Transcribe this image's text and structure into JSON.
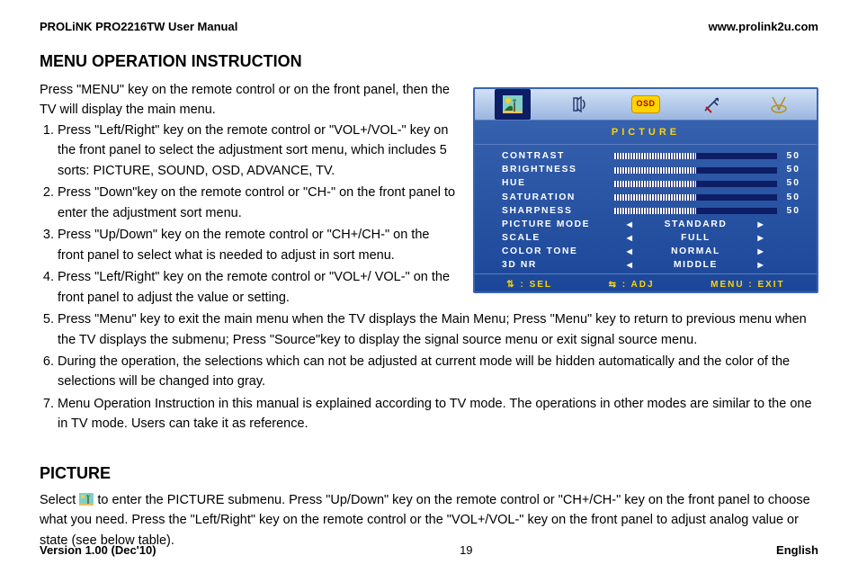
{
  "header": {
    "left": "PROLiNK PRO2216TW User Manual",
    "right": "www.prolink2u.com"
  },
  "section1": {
    "title": "MENU OPERATION INSTRUCTION",
    "lead": "Press \"MENU\" key on the remote control or on the front panel, then the TV will display the main menu.",
    "steps": [
      "Press \"Left/Right\" key on the remote control or \"VOL+/VOL-\" key on the front panel to select the adjustment sort menu, which includes 5 sorts: PICTURE, SOUND, OSD, ADVANCE, TV.",
      "Press \"Down\"key on the remote control or \"CH-\" on the front panel to enter the adjustment sort menu.",
      "Press \"Up/Down\" key on the remote control or \"CH+/CH-\" on the front panel to select what is needed to adjust in sort menu.",
      "Press \"Left/Right\" key on the remote control or \"VOL+/ VOL-\" on the front panel to adjust the value or setting.",
      "Press \"Menu\" key to exit  the main menu when the TV displays the Main Menu; Press \"Menu\" key to return to previous menu when the TV displays the submenu; Press \"Source\"key to display the signal source menu or exit signal source menu.",
      "During the operation, the selections which can not be adjusted at current mode will be hidden automatically and the color of the selections will be changed into gray.",
      "Menu Operation Instruction in this manual is explained according to TV mode. The operations in other modes are similar to the one in TV mode. Users can take it as reference."
    ]
  },
  "osd": {
    "title": "PICTURE",
    "tabs": [
      {
        "name": "picture-tab-icon",
        "active": true
      },
      {
        "name": "sound-tab-icon",
        "active": false
      },
      {
        "name": "osd-tab-icon",
        "active": false,
        "osd": true,
        "label": "OSD"
      },
      {
        "name": "advance-tab-icon",
        "active": false
      },
      {
        "name": "tv-tab-icon",
        "active": false
      }
    ],
    "sliders": [
      {
        "label": "CONTRAST",
        "value": "50"
      },
      {
        "label": "BRIGHTNESS",
        "value": "50"
      },
      {
        "label": "HUE",
        "value": "50"
      },
      {
        "label": "SATURATION",
        "value": "50"
      },
      {
        "label": "SHARPNESS",
        "value": "50"
      }
    ],
    "selects": [
      {
        "label": "PICTURE MODE",
        "value": "STANDARD"
      },
      {
        "label": "SCALE",
        "value": "FULL"
      },
      {
        "label": "COLOR TONE",
        "value": "NORMAL"
      },
      {
        "label": "3D NR",
        "value": "MIDDLE"
      }
    ],
    "footer": {
      "sel": "⇅ : SEL",
      "adj": "⇆ : ADJ",
      "exit": "MENU : EXIT"
    }
  },
  "section2": {
    "title": "PICTURE",
    "body_before": "Select ",
    "body_after": " to enter the PICTURE submenu. Press \"Up/Down\" key on the remote control or \"CH+/CH-\" key on the front panel to choose what you need. Press the \"Left/Right\" key on the remote control or the \"VOL+/VOL-\" key on the front panel to adjust analog value or state (see below table)."
  },
  "footer": {
    "left": "Version 1.00 (Dec'10)",
    "center": "19",
    "right": "English"
  }
}
